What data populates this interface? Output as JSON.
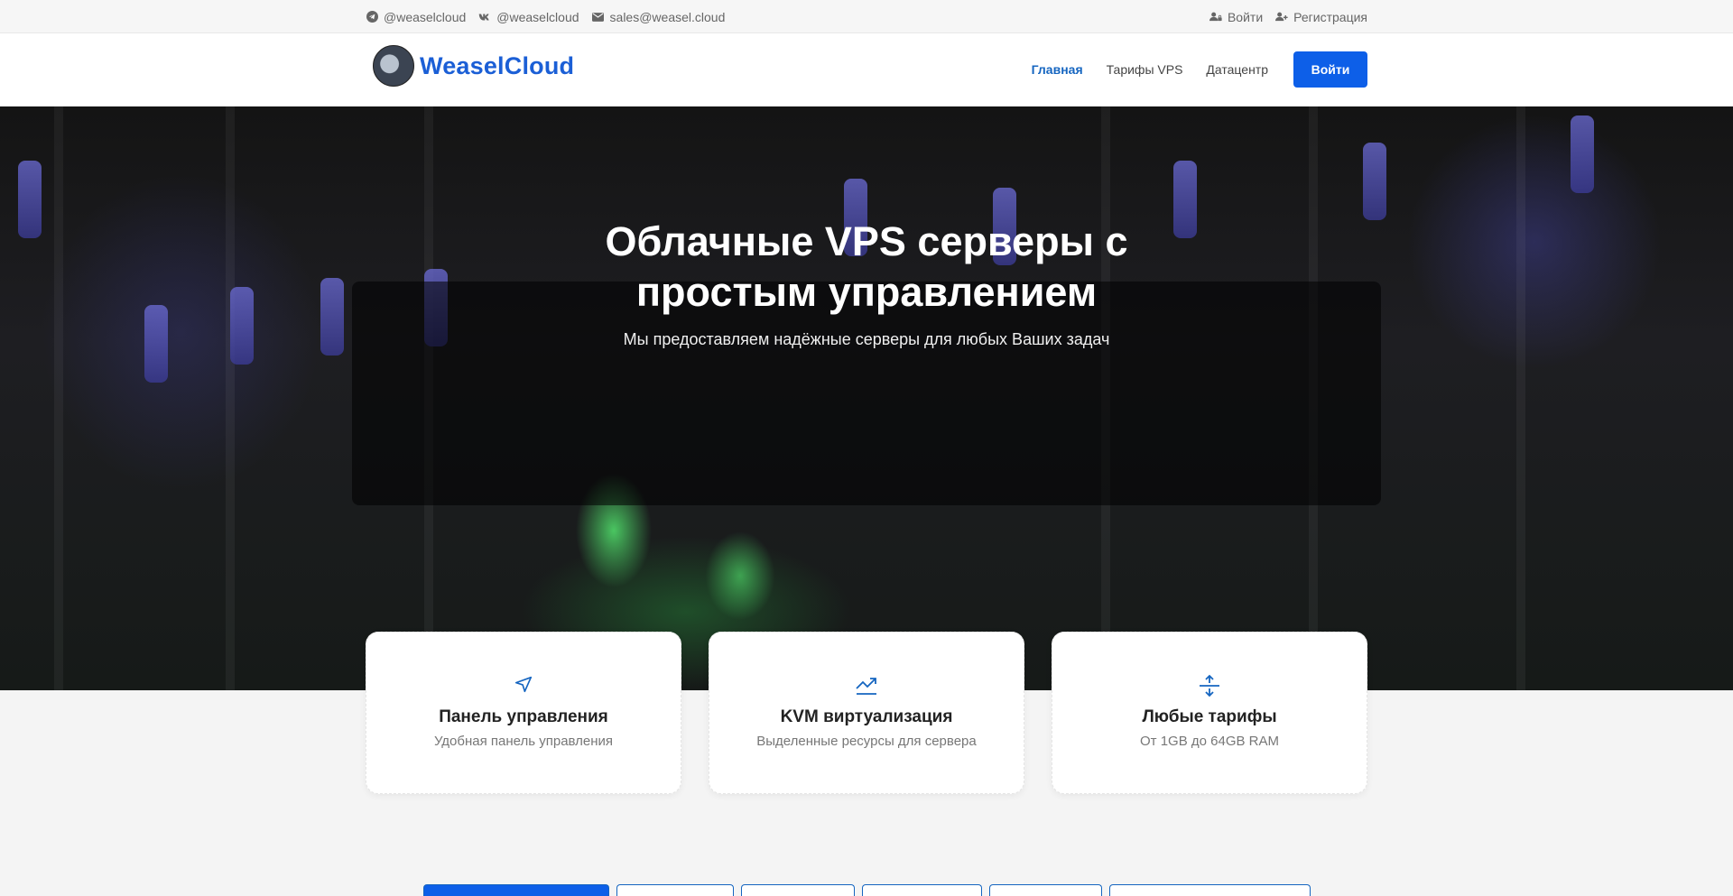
{
  "topbar": {
    "telegram": "@weaselcloud",
    "vk": "@weaselcloud",
    "email": "sales@weasel.cloud",
    "login": "Войти",
    "register": "Регистрация"
  },
  "header": {
    "brand": "WeaselCloud",
    "nav": {
      "home": "Главная",
      "tariffs": "Тарифы VPS",
      "datacenter": "Датацентр"
    },
    "login_button": "Войти"
  },
  "hero": {
    "title_line1": "Облачные VPS серверы с",
    "title_line2": "простым управлением",
    "subtitle": "Мы предоставляем надёжные серверы для любых Ваших задач"
  },
  "features": [
    {
      "icon": "cursor-icon",
      "title": "Панель управления",
      "desc": "Удобная панель управления"
    },
    {
      "icon": "trending-up-icon",
      "title": "KVM виртуализация",
      "desc": "Выделенные ресурсы для сервера"
    },
    {
      "icon": "expand-vertical-icon",
      "title": "Любые тарифы",
      "desc": "От 1GB до 64GB RAM"
    }
  ],
  "colors": {
    "accent": "#0d5fe8",
    "brand": "#1b5fd6",
    "nav_active": "#1565c0"
  }
}
